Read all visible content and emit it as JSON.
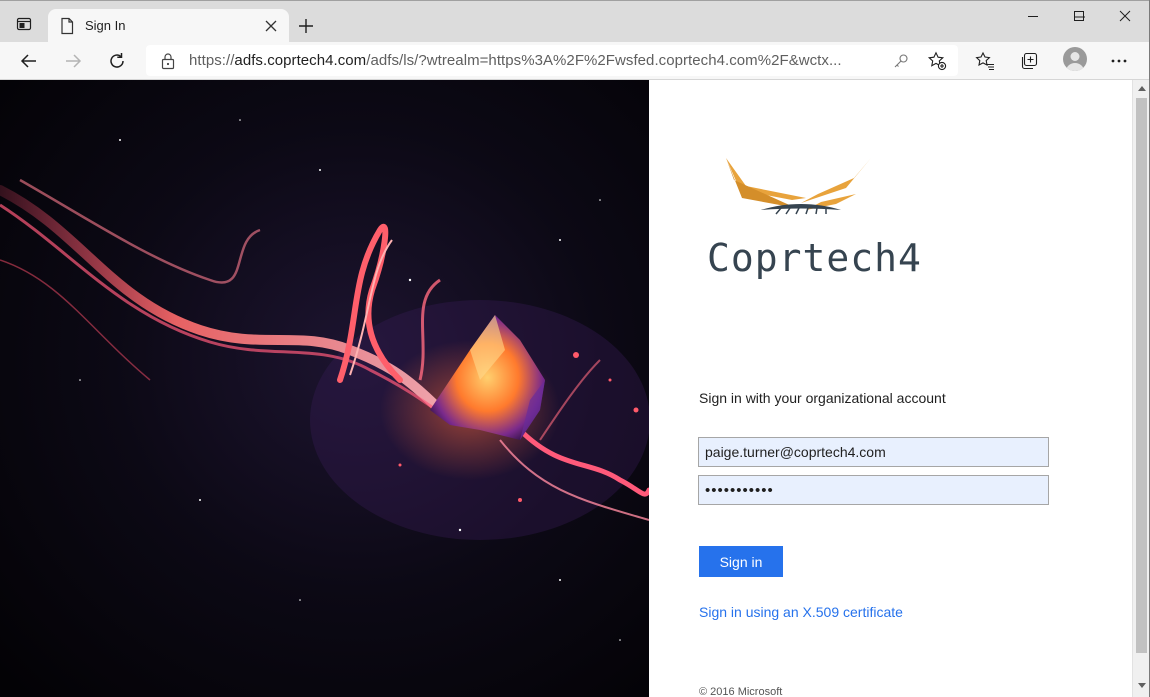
{
  "browser": {
    "tab": {
      "title": "Sign In"
    },
    "address": {
      "url_host_prefix": "https://",
      "url_host": "adfs.coprtech4.com",
      "url_rest": "/adfs/ls/?wtrealm=https%3A%2F%2Fwsfed.coprtech4.com%2F&wctx..."
    },
    "icons": {
      "window": "tab-actions-icon",
      "favicon": "page-icon",
      "close": "close-icon",
      "new_tab": "plus-icon",
      "back": "back-arrow-icon",
      "forward": "forward-arrow-icon",
      "refresh": "refresh-icon",
      "lock": "lock-icon",
      "key": "key-icon",
      "add_favorite": "star-plus-icon",
      "favorites": "favorites-icon",
      "collections": "collections-icon",
      "profile": "profile-avatar",
      "more": "more-icon"
    }
  },
  "page": {
    "brand": {
      "name": "Coprtech4",
      "colors": {
        "wing": "#e8a33c",
        "text": "#364450"
      }
    },
    "prompt": "Sign in with your organizational account",
    "email": {
      "value": "paige.turner@coprtech4.com"
    },
    "password": {
      "masked": "•••••••••••"
    },
    "signin_button": "Sign in",
    "cert_link": "Sign in using an X.509 certificate",
    "copyright": "© 2016 Microsoft",
    "colors": {
      "accent": "#2672ec",
      "autofill": "#e8f0fe"
    }
  }
}
